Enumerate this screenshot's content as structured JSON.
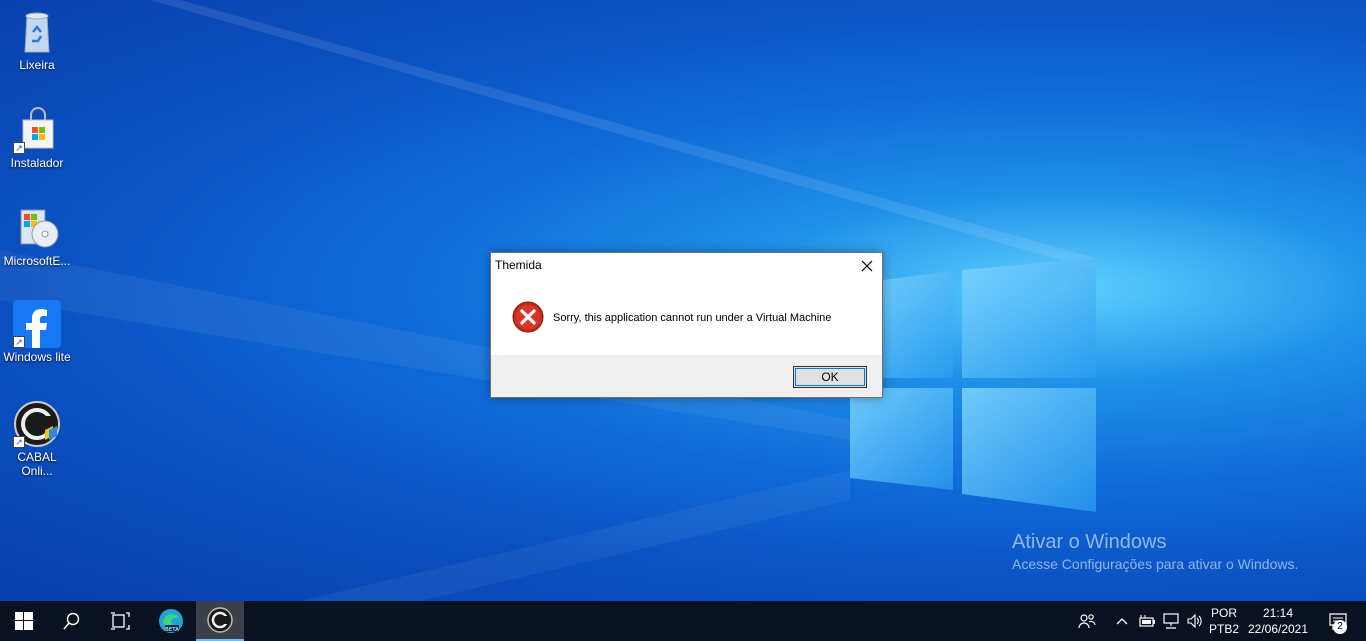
{
  "desktop": {
    "icons": [
      {
        "label": "Lixeira",
        "icon": "recycle-bin-icon"
      },
      {
        "label": "Instalador",
        "icon": "store-bag-icon"
      },
      {
        "label": "MicrosoftE...",
        "icon": "installer-cd-icon"
      },
      {
        "label": "Windows lite",
        "icon": "facebook-icon"
      },
      {
        "label": "CABAL Onli...",
        "icon": "cabal-icon"
      }
    ],
    "watermark": {
      "line1": "Ativar o Windows",
      "line2": "Acesse Configurações para ativar o Windows."
    }
  },
  "dialog": {
    "title": "Themida",
    "message": "Sorry, this application cannot run under a Virtual Machine",
    "ok_label": "OK",
    "icon": "error-icon"
  },
  "taskbar": {
    "buttons": [
      "start-icon",
      "search-icon",
      "task-view-icon",
      "edge-beta-icon",
      "cabal-icon"
    ],
    "tray": {
      "lang_line1": "POR",
      "lang_line2": "PTB2",
      "time": "21:14",
      "date": "22/06/2021",
      "notifications": "2"
    }
  },
  "colors": {
    "desktop_accent": "#0f6ad8",
    "taskbar": "#0a1120",
    "error_red": "#c42b1c",
    "focus_blue": "#0078d7"
  }
}
